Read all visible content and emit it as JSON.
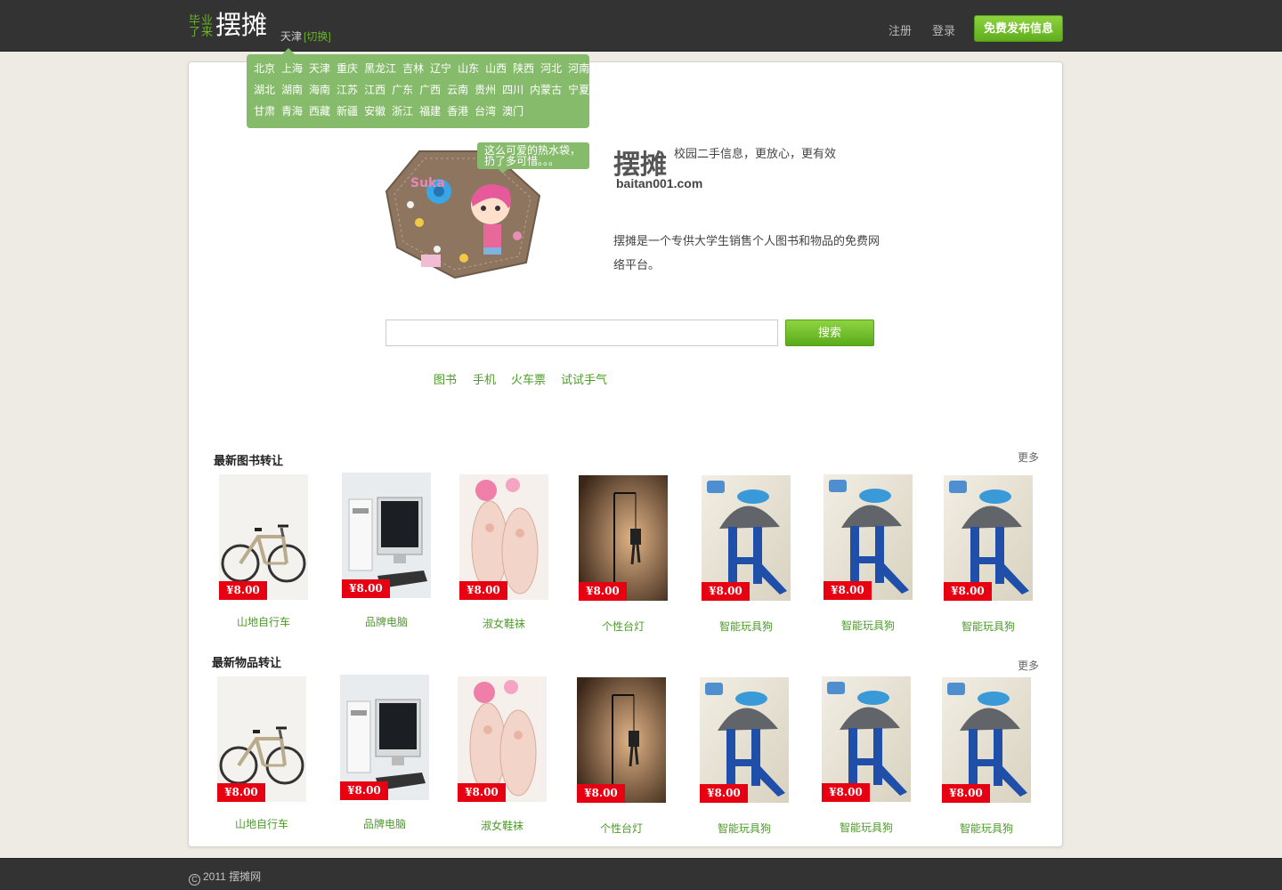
{
  "header": {
    "logo_small_line1": "毕业",
    "logo_small_line2": "了来",
    "logo_big": "摆摊",
    "city": "天津",
    "city_switch": "[切换]",
    "register": "注册",
    "login": "登录",
    "post_button": "免费发布信息"
  },
  "city_popup": {
    "rows": [
      [
        "北京",
        "上海",
        "天津",
        "重庆",
        "黑龙江",
        "吉林",
        "辽宁",
        "山东",
        "山西",
        "陕西",
        "河北",
        "河南"
      ],
      [
        "湖北",
        "湖南",
        "海南",
        "江苏",
        "江西",
        "广东",
        "广西",
        "云南",
        "贵州",
        "四川",
        "内蒙古",
        "宁夏"
      ],
      [
        "甘肃",
        "青海",
        "西藏",
        "新疆",
        "安徽",
        "浙江",
        "福建",
        "香港",
        "台湾",
        "澳门"
      ]
    ]
  },
  "hero": {
    "bubble_text": "这么可爱的热水袋，扔了多可惜。。。",
    "brand_title": "摆摊",
    "brand_slogan": "校园二手信息，更放心，更有效",
    "brand_url": "baitan001.com",
    "description": "摆摊是一个专供大学生销售个人图书和物品的免费网络平台。"
  },
  "search": {
    "value": "",
    "placeholder": "",
    "button": "搜索",
    "quick_links": [
      "图书",
      "手机",
      "火车票",
      "试试手气"
    ]
  },
  "sections": [
    {
      "title": "最新图书转让",
      "more": "更多",
      "items": [
        {
          "name": "山地自行车",
          "price": "¥8.00",
          "image": "bike"
        },
        {
          "name": "品牌电脑",
          "price": "¥8.00",
          "image": "computer"
        },
        {
          "name": "淑女鞋袜",
          "price": "¥8.00",
          "image": "shoes"
        },
        {
          "name": "个性台灯",
          "price": "¥8.00",
          "image": "lamp"
        },
        {
          "name": "智能玩具狗",
          "price": "¥8.00",
          "image": "dog-lamp"
        },
        {
          "name": "智能玩具狗",
          "price": "¥8.00",
          "image": "dog-lamp"
        },
        {
          "name": "智能玩具狗",
          "price": "¥8.00",
          "image": "dog-lamp"
        }
      ]
    },
    {
      "title": "最新物品转让",
      "more": "更多",
      "items": [
        {
          "name": "山地自行车",
          "price": "¥8.00",
          "image": "bike"
        },
        {
          "name": "品牌电脑",
          "price": "¥8.00",
          "image": "computer"
        },
        {
          "name": "淑女鞋袜",
          "price": "¥8.00",
          "image": "shoes"
        },
        {
          "name": "个性台灯",
          "price": "¥8.00",
          "image": "lamp"
        },
        {
          "name": "智能玩具狗",
          "price": "¥8.00",
          "image": "dog-lamp"
        },
        {
          "name": "智能玩具狗",
          "price": "¥8.00",
          "image": "dog-lamp"
        },
        {
          "name": "智能玩具狗",
          "price": "¥8.00",
          "image": "dog-lamp"
        }
      ]
    }
  ],
  "footer": {
    "copyright_symbol": "C",
    "copyright": "2011 摆摊网"
  },
  "colors": {
    "topbar": "#333333",
    "accent_green": "#6ab32a",
    "popup_green": "#86bb6c",
    "price_red": "#e60012",
    "link_green": "#4e9a2a"
  }
}
